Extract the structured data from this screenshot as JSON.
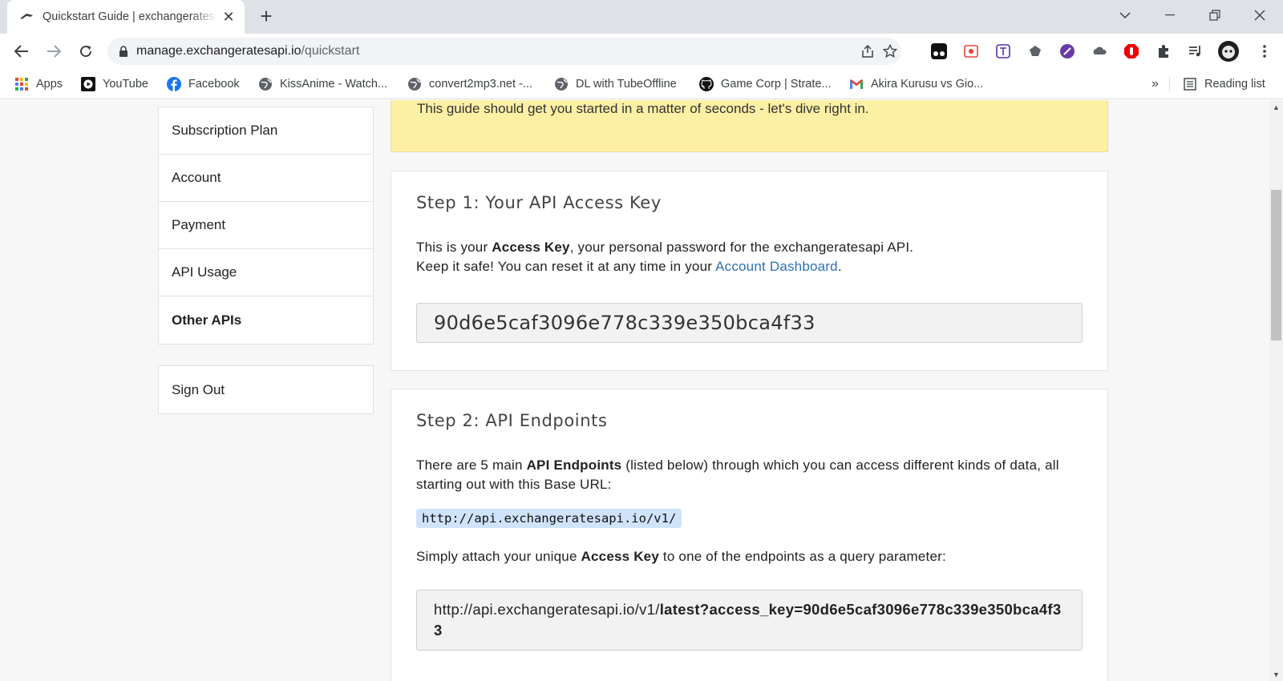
{
  "browser": {
    "tab_title": "Quickstart Guide | exchangerates",
    "new_tab": "+",
    "url_host": "manage.exchangeratesapi.io",
    "url_path": "/quickstart",
    "bookmarks": [
      {
        "label": "Apps",
        "icon": "apps-grid-icon"
      },
      {
        "label": "YouTube",
        "icon": "youtube-icon"
      },
      {
        "label": "Facebook",
        "icon": "facebook-icon"
      },
      {
        "label": "KissAnime - Watch...",
        "icon": "globe-icon"
      },
      {
        "label": "convert2mp3.net -...",
        "icon": "globe-icon"
      },
      {
        "label": "DL with TubeOffline",
        "icon": "globe-icon"
      },
      {
        "label": "Game Corp | Strate...",
        "icon": "github-icon"
      },
      {
        "label": "Akira Kurusu vs Gio...",
        "icon": "gmail-icon"
      }
    ],
    "bookmarks_overflow": "»",
    "reading_list": "Reading list"
  },
  "sidebar": {
    "items": [
      {
        "label": "Subscription Plan"
      },
      {
        "label": "Account"
      },
      {
        "label": "Payment"
      },
      {
        "label": "API Usage"
      },
      {
        "label": "Other APIs"
      }
    ],
    "sign_out": "Sign Out"
  },
  "intro": {
    "text": "This guide should get you started in a matter of seconds - let's dive right in."
  },
  "step1": {
    "title": "Step 1: Your API Access Key",
    "line1_pre": "This is your ",
    "line1_bold": "Access Key",
    "line1_post": ", your personal password for the exchangeratesapi API.",
    "line2_pre": "Keep it safe! You can reset it at any time in your ",
    "line2_link": "Account Dashboard",
    "line2_post": ".",
    "access_key": "90d6e5caf3096e778c339e350bca4f33"
  },
  "step2": {
    "title": "Step 2: API Endpoints",
    "para1_pre": "There are 5 main ",
    "para1_bold": "API Endpoints",
    "para1_post": " (listed below) through which you can access different kinds of data, all starting out with this Base URL:",
    "base_url": "http://api.exchangeratesapi.io/v1/",
    "para2_pre": "Simply attach your unique ",
    "para2_bold": "Access Key",
    "para2_post": " to one of the endpoints as a query parameter:",
    "example_url_base": "http://api.exchangeratesapi.io/v1/",
    "example_url_bold": "latest?access_key=90d6e5caf3096e778c339e350bca4f33"
  },
  "colors": {
    "banner_bg": "#fdf0a5",
    "link": "#2f6eb5",
    "code_chip_bg": "#cfe3fb"
  }
}
